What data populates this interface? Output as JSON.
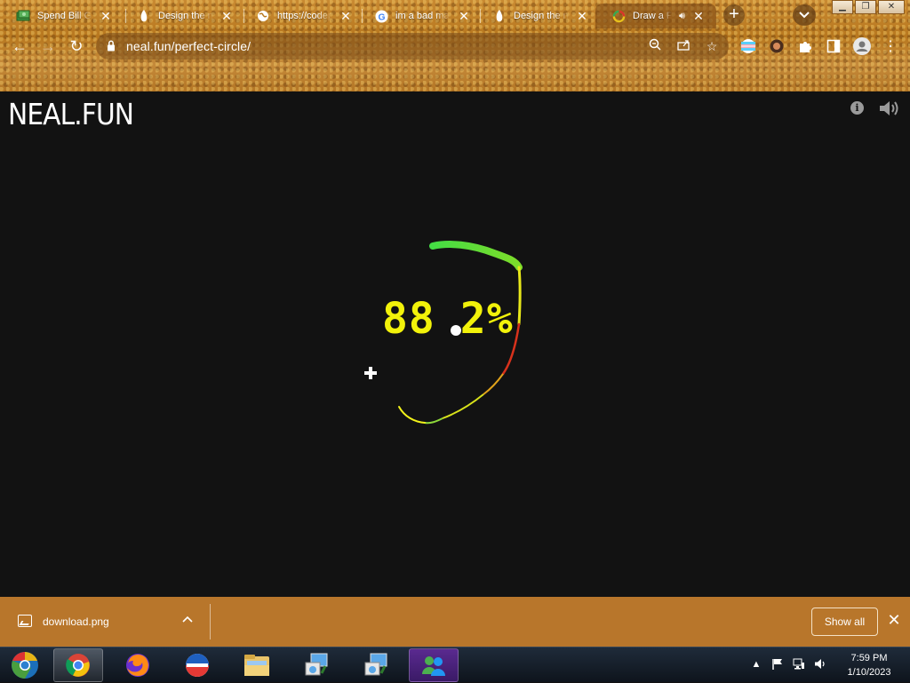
{
  "browser": {
    "tabs": [
      {
        "title": "Spend Bill Gates' Money",
        "icon": "money-icon"
      },
      {
        "title": "Design the next iPhone",
        "icon": "neal-fun-icon"
      },
      {
        "title": "https://codepen.io",
        "icon": "globe-icon"
      },
      {
        "title": "im a bad man",
        "icon": "google-icon"
      },
      {
        "title": "Design the next iPhone",
        "icon": "neal-fun-icon"
      },
      {
        "title": "Draw a Perfect Circle",
        "icon": "circle-icon",
        "active": true
      }
    ],
    "url": "neal.fun/perfect-circle/"
  },
  "page": {
    "logo": "NEAL.FUN",
    "score": "88",
    "score_decimal": "2%",
    "colors": {
      "background": "#121212",
      "score": "#f2f20a",
      "green": "#4ee04e",
      "yellow": "#f2f20a",
      "red": "#e0301a"
    }
  },
  "downloads": {
    "file_name": "download.png",
    "show_all_label": "Show all"
  },
  "taskbar": {
    "apps": [
      "chrome-canary",
      "chrome",
      "firefox",
      "opera",
      "file-explorer",
      "setup-program",
      "setup-program-2",
      "windows-live-messenger"
    ],
    "time": "7:59 PM",
    "date": "1/10/2023"
  }
}
